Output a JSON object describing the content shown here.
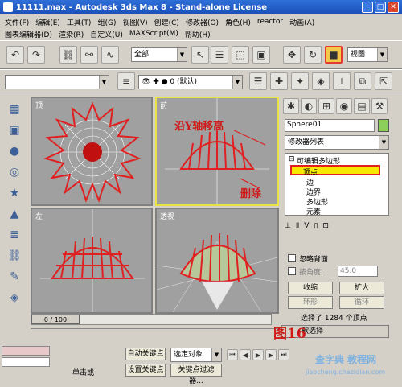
{
  "window": {
    "title": "11111.max - Autodesk 3ds Max 8 - Stand-alone License",
    "minimize": "_",
    "maximize": "□",
    "close": "✕"
  },
  "menu": {
    "row1": [
      "文件(F)",
      "编辑(E)",
      "工具(T)",
      "组(G)",
      "视图(V)",
      "创建(C)",
      "修改器(O)",
      "角色(H)",
      "reactor",
      "动画(A)"
    ],
    "row2": [
      "图表编辑器(D)",
      "渲染(R)",
      "自定义(U)",
      "MAXScript(M)",
      "帮助(H)"
    ]
  },
  "toolbar1": {
    "selection_filter": "全部",
    "view_combo": "视图"
  },
  "toolbar2": {
    "layer": "0 (默认)"
  },
  "viewports": {
    "top": {
      "label": "顶"
    },
    "front": {
      "label": "前"
    },
    "left": {
      "label": "左"
    },
    "perspective": {
      "label": "透视"
    }
  },
  "annotations": {
    "front_note": "沿Y轴移高",
    "delete_note": "删除",
    "figure_num": "图16"
  },
  "command_panel": {
    "object_name": "Sphere01",
    "modifier_list": "修改器列表",
    "stack": {
      "root": "可编辑多边形",
      "items": [
        "顶点",
        "边",
        "边界",
        "多边形",
        "元素"
      ],
      "selected_index": 0
    },
    "ignore_backfacing": "忽略背面",
    "by_angle_label": "按角度:",
    "by_angle_value": "45.0",
    "shrink": "收缩",
    "grow": "扩大",
    "ring": "环形",
    "loop": "循环",
    "selection_info": "选择了 1284 个顶点",
    "soft_select": "软选择"
  },
  "timeline": {
    "position": "0 / 100"
  },
  "status": {
    "single_object": "单击或",
    "auto_key": "自动关键点",
    "set_key": "设置关键点",
    "selected_object": "选定对象",
    "key_filter": "关键点过滤器...",
    "watermark": "jiaocheng.chazidian.com",
    "watermark2": "查字典 教程网"
  }
}
